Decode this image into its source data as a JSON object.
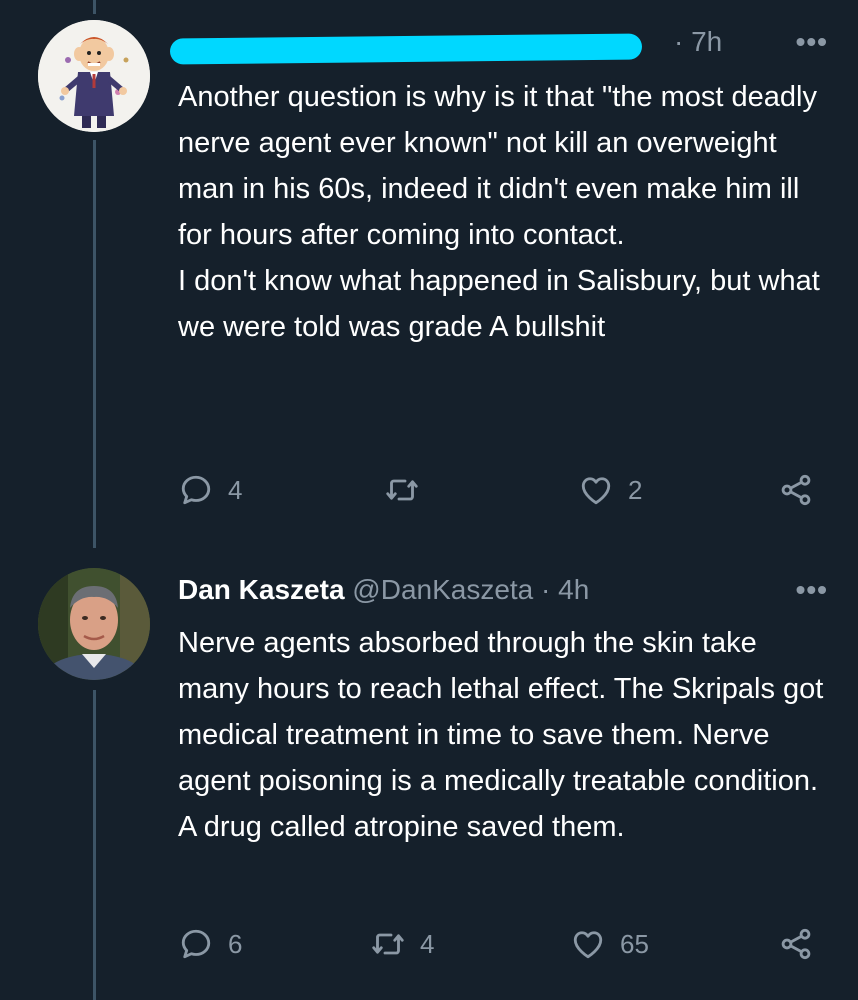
{
  "tweets": [
    {
      "name": "",
      "handle": "",
      "time": "· 7h",
      "more": "•••",
      "body": [
        "Another question is why is it that \"the most deadly nerve agent ever known\" not kill an overweight man in his 60s, indeed it didn't even make him ill for hours after coming into contact.",
        "I don't know what happened in Salisbury, but what we were told was grade A bullshit"
      ],
      "replies": "4",
      "retweets": "",
      "likes": "2"
    },
    {
      "name": "Dan Kaszeta",
      "handle": "@DanKaszeta",
      "time": "· 4h",
      "more": "•••",
      "body": [
        "Nerve agents absorbed through the skin take many hours to reach lethal effect. The Skripals got medical treatment in time to save them. Nerve agent poisoning is a medically treatable condition. A drug called atropine saved them."
      ],
      "replies": "6",
      "retweets": "4",
      "likes": "65"
    }
  ],
  "colors": {
    "background": "#15202b",
    "muted": "#8b98a5",
    "redaction": "#00d8ff",
    "thread_line": "#3d5466"
  },
  "icons": [
    "reply-icon",
    "retweet-icon",
    "like-icon",
    "share-icon"
  ]
}
